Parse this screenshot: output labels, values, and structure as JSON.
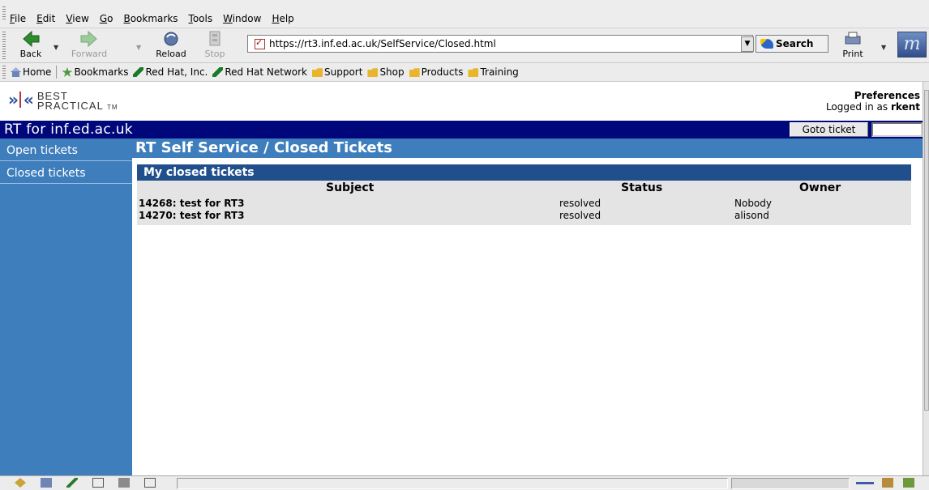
{
  "menu": [
    "File",
    "Edit",
    "View",
    "Go",
    "Bookmarks",
    "Tools",
    "Window",
    "Help"
  ],
  "menu_mnemonics": [
    "F",
    "E",
    "V",
    "G",
    "B",
    "T",
    "W",
    "H"
  ],
  "nav": {
    "back": "Back",
    "forward": "Forward",
    "reload": "Reload",
    "stop": "Stop",
    "print": "Print",
    "search": "Search"
  },
  "address": {
    "url": "https://rt3.inf.ed.ac.uk/SelfService/Closed.html"
  },
  "bookmarks_bar": [
    {
      "label": "Home",
      "icon": "home-icon"
    },
    {
      "label": "Bookmarks",
      "icon": "bookmarks-icon"
    },
    {
      "label": "Red Hat, Inc.",
      "icon": "link-icon"
    },
    {
      "label": "Red Hat Network",
      "icon": "link-icon"
    },
    {
      "label": "Support",
      "icon": "folder-icon"
    },
    {
      "label": "Shop",
      "icon": "folder-icon"
    },
    {
      "label": "Products",
      "icon": "folder-icon"
    },
    {
      "label": "Training",
      "icon": "folder-icon"
    }
  ],
  "rt": {
    "logo_line1": "BEST",
    "logo_line2": "PRACTICAL",
    "logo_tm": "TM",
    "preferences": "Preferences",
    "logged_in_prefix": "Logged in as",
    "username": "rkent",
    "site_title": "RT for inf.ed.ac.uk",
    "goto_button": "Goto ticket",
    "sidebar": [
      "Open tickets",
      "Closed tickets"
    ],
    "page_title": "RT Self Service / Closed Tickets",
    "section_title": "My closed tickets",
    "columns": [
      "Subject",
      "Status",
      "Owner"
    ],
    "tickets": [
      {
        "subject": "14268: test for RT3",
        "status": "resolved",
        "owner": "Nobody"
      },
      {
        "subject": "14270: test for RT3",
        "status": "resolved",
        "owner": "alisond"
      }
    ]
  },
  "colors": {
    "title_bar": "#00077b",
    "sidebar": "#3e7ebd",
    "section_bar": "#204f8c",
    "table_bg": "#e4e4e4"
  }
}
